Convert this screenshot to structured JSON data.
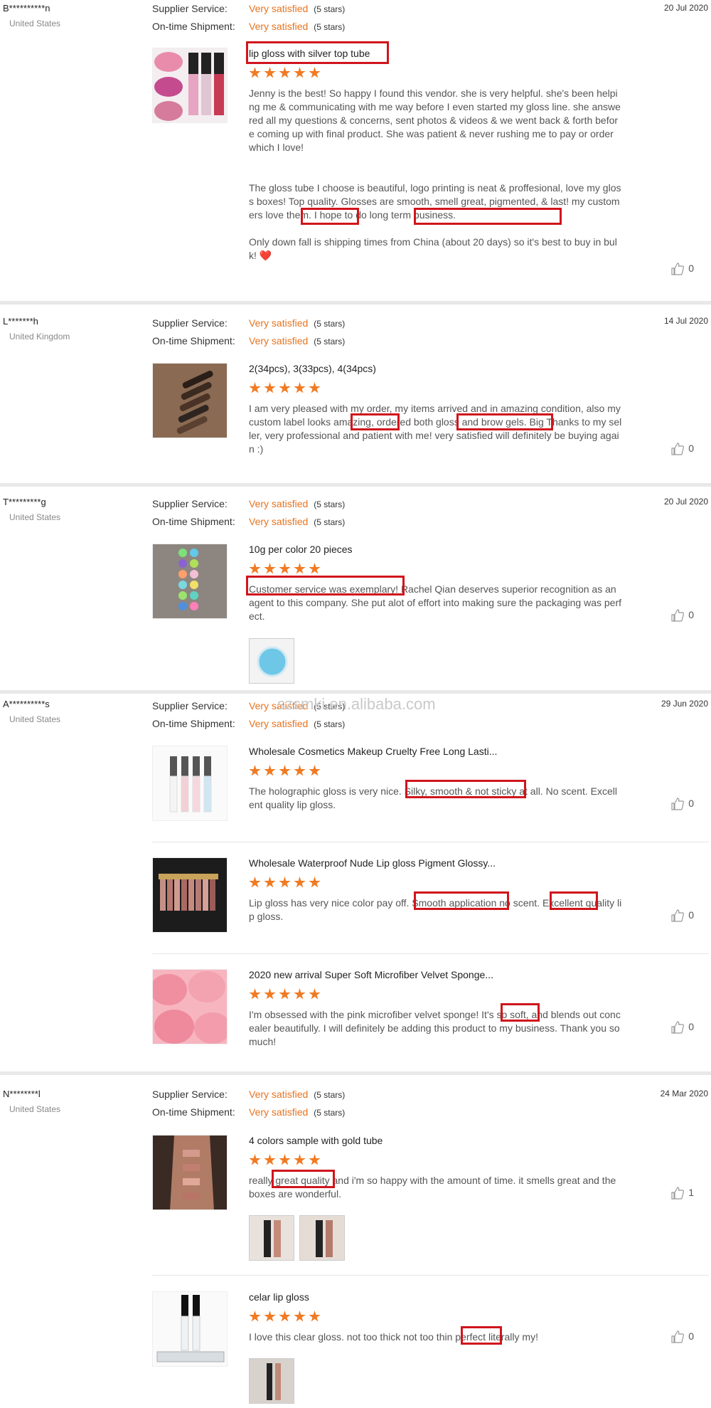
{
  "labels": {
    "supplier_service": "Supplier Service:",
    "ontime_shipment": "On-time Shipment:",
    "very_satisfied": "Very satisfied",
    "five_stars": "(5 stars)"
  },
  "watermark": "szsmki.en.alibaba.com",
  "reviews": [
    {
      "buyer": "B**********n",
      "country": "United States",
      "date": "20 Jul 2020",
      "items": [
        {
          "title": "lip gloss with silver top tube",
          "stars": 5,
          "text": "Jenny is the best! So happy I found this vendor. she is very helpful. she's been helping me & communicating with me way before I even started my gloss line. she answered all my questions & concerns, sent photos & videos & we went back & forth before coming up with final product. She was patient & never rushing me to pay or order\nwhich I love!\n\n\nThe gloss tube I choose is beautiful, logo printing is neat & proffesional, love my gloss boxes! Top quality. Glosses are smooth, smell great, pigmented, & last! my customers love them. I hope to do long term business.\n\nOnly down fall is shipping times from China (about 20 days) so it's best to buy in bulk!  ❤️",
          "likes": "0"
        }
      ]
    },
    {
      "buyer": "L*******h",
      "country": "United Kingdom",
      "date": "14 Jul 2020",
      "items": [
        {
          "title": "2(34pcs), 3(33pcs), 4(34pcs)",
          "stars": 5,
          "text": "I am very pleased with my order, my items arrived and in amazing condition, also my custom label looks amazing, ordered both gloss and brow gels. Big Thanks to my seller, very professional and patient with me! very satisfied will definitely be buying again :)",
          "likes": "0"
        }
      ]
    },
    {
      "buyer": "T*********g",
      "country": "United States",
      "date": "20 Jul 2020",
      "items": [
        {
          "title": "10g per color 20 pieces",
          "stars": 5,
          "text": "Customer service was exemplary! Rachel Qian deserves superior recognition as an agent to this company. She put alot of effort into making sure the packaging was perfect.",
          "likes": "0"
        }
      ]
    },
    {
      "buyer": "A**********s",
      "country": "United States",
      "date": "29 Jun 2020",
      "items": [
        {
          "title": "Wholesale Cosmetics Makeup Cruelty Free Long Lasti...",
          "stars": 5,
          "text": "The holographic gloss is very nice. Silky, smooth & not sticky at all. No scent. Excellent quality lip gloss.",
          "likes": "0"
        },
        {
          "title": "Wholesale Waterproof Nude Lip gloss Pigment Glossy...",
          "stars": 5,
          "text": "Lip gloss has very nice color pay off. Smooth application no scent. Excellent quality lip gloss.",
          "likes": "0"
        },
        {
          "title": "2020 new arrival Super Soft Microfiber Velvet Sponge...",
          "stars": 5,
          "text": "I'm obsessed with the pink microfiber velvet sponge! It's so soft, and blends out concealer beautifully. I will definitely be adding this product to my business. Thank you so much!",
          "likes": "0"
        }
      ]
    },
    {
      "buyer": "N********l",
      "country": "United States",
      "date": "24 Mar 2020",
      "items": [
        {
          "title": "4 colors sample with gold tube",
          "stars": 5,
          "text": "really great quality and i'm so happy with the amount of time. it smells great and the boxes are wonderful.",
          "likes": "1"
        },
        {
          "title": "celar lip gloss",
          "stars": 5,
          "text": "I love this clear gloss. not too thick not too thin perfect literally my!",
          "likes": "0"
        }
      ]
    }
  ]
}
